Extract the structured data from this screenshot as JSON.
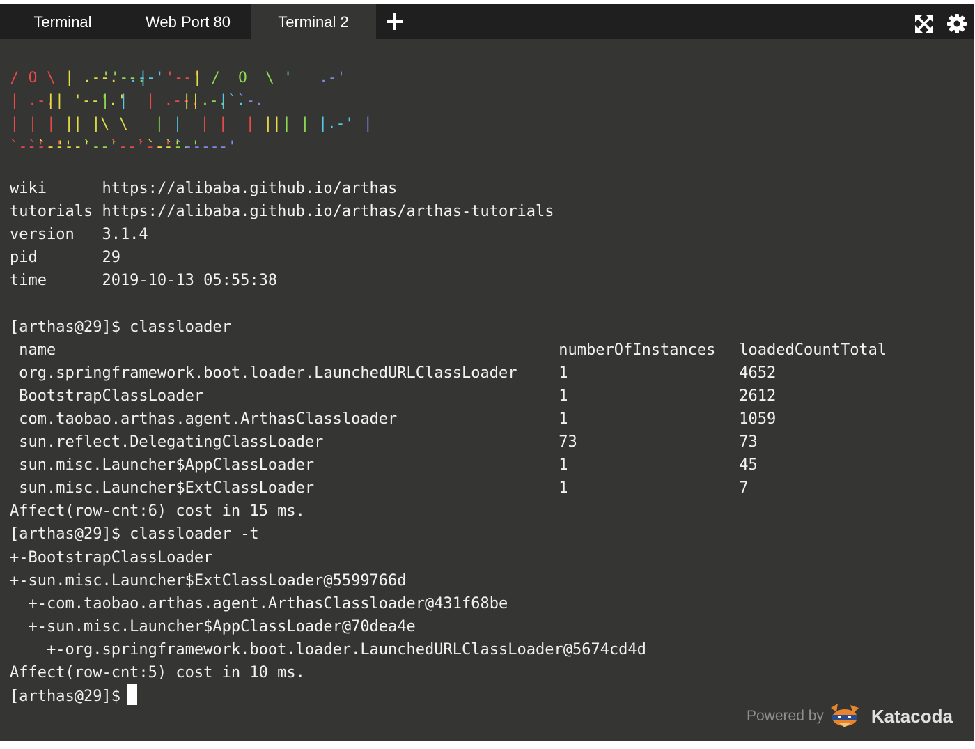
{
  "tabs": [
    {
      "label": "Terminal"
    },
    {
      "label": "Web Port 80"
    },
    {
      "label": "Terminal 2"
    }
  ],
  "toolbar": {
    "add_tab_icon": "plus-icon",
    "expand_icon": "expand-icon",
    "settings_icon": "gear-icon"
  },
  "colors": {
    "background": "#353533",
    "tabbar": "#1f1f1f",
    "logo_red": "#e84a4a",
    "logo_yellow": "#e6dd45",
    "logo_green": "#8ddc4f",
    "logo_cyan": "#56c9e8",
    "logo_purple": "#7e8cf0"
  },
  "terminal": {
    "info_lines": [
      "wiki      https://alibaba.github.io/arthas",
      "tutorials https://alibaba.github.io/arthas/arthas-tutorials",
      "version   3.1.4",
      "pid       29",
      "time      2019-10-13 05:55:38"
    ],
    "prompt1": "[arthas@29]$ classloader",
    "table": {
      "headers": [
        "name",
        "numberOfInstances",
        "loadedCountTotal"
      ],
      "rows": [
        [
          "org.springframework.boot.loader.LaunchedURLClassLoader",
          "1",
          "4652"
        ],
        [
          "BootstrapClassLoader",
          "1",
          "2612"
        ],
        [
          "com.taobao.arthas.agent.ArthasClassloader",
          "1",
          "1059"
        ],
        [
          "sun.reflect.DelegatingClassLoader",
          "73",
          "73"
        ],
        [
          "sun.misc.Launcher$AppClassLoader",
          "1",
          "45"
        ],
        [
          "sun.misc.Launcher$ExtClassLoader",
          "1",
          "7"
        ]
      ]
    },
    "affect1": "Affect(row-cnt:6) cost in 15 ms.",
    "prompt2": "[arthas@29]$ classloader -t",
    "tree": [
      "+-BootstrapClassLoader",
      "+-sun.misc.Launcher$ExtClassLoader@5599766d",
      "  +-com.taobao.arthas.agent.ArthasClassloader@431f68be",
      "  +-sun.misc.Launcher$AppClassLoader@70dea4e",
      "    +-org.springframework.boot.loader.LaunchedURLClassLoader@5674cd4d"
    ],
    "affect2": "Affect(row-cnt:5) cost in 10 ms.",
    "prompt3": "[arthas@29]$"
  },
  "footer": {
    "powered_by": "Powered by",
    "brand": "Katacoda",
    "logo_icon": "katacoda-logo-icon"
  }
}
